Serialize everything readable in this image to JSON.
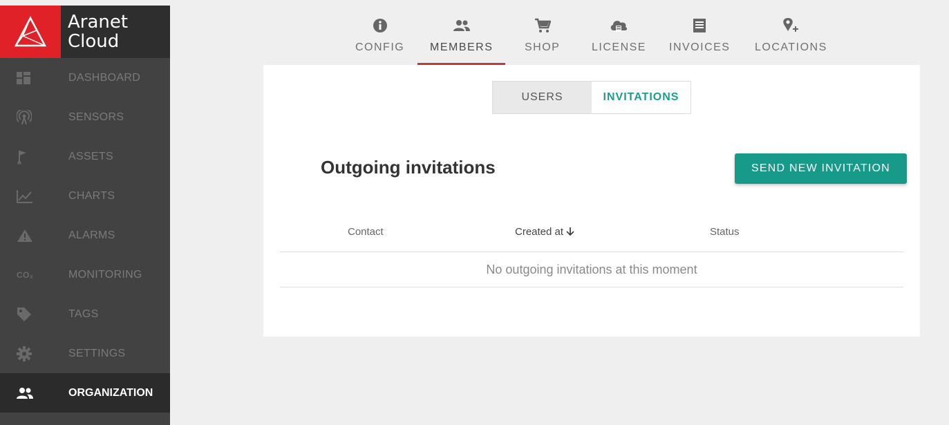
{
  "brand": {
    "line1": "Aranet",
    "line2": "Cloud",
    "logo_color": "#e02128"
  },
  "sidebar": {
    "items": [
      {
        "label": "DASHBOARD",
        "icon": "dashboard-icon"
      },
      {
        "label": "SENSORS",
        "icon": "sensor-signal-icon"
      },
      {
        "label": "ASSETS",
        "icon": "flag-icon"
      },
      {
        "label": "CHARTS",
        "icon": "chart-line-icon"
      },
      {
        "label": "ALARMS",
        "icon": "warning-icon"
      },
      {
        "label": "MONITORING",
        "icon": "co2-icon",
        "icon_text": "CO₂"
      },
      {
        "label": "TAGS",
        "icon": "tag-icon"
      },
      {
        "label": "SETTINGS",
        "icon": "gear-icon"
      },
      {
        "label": "ORGANIZATION",
        "icon": "people-icon",
        "active": true
      }
    ]
  },
  "topnav": {
    "tabs": [
      {
        "label": "CONFIG",
        "icon": "info-icon"
      },
      {
        "label": "MEMBERS",
        "icon": "people-icon",
        "active": true
      },
      {
        "label": "SHOP",
        "icon": "cart-icon"
      },
      {
        "label": "LICENSE",
        "icon": "cloud-license-icon"
      },
      {
        "label": "INVOICES",
        "icon": "document-icon"
      },
      {
        "label": "LOCATIONS",
        "icon": "location-add-icon"
      }
    ]
  },
  "segment": {
    "users": "USERS",
    "invitations": "INVITATIONS",
    "active": "INVITATIONS"
  },
  "main": {
    "title": "Outgoing invitations",
    "send_button": "SEND NEW INVITATION",
    "columns": {
      "contact": "Contact",
      "created": "Created at",
      "status": "Status"
    },
    "empty_message": "No outgoing invitations at this moment"
  },
  "colors": {
    "accent": "#179a89",
    "active_tab_underline": "#c0393b",
    "sidebar_bg": "#424242"
  }
}
